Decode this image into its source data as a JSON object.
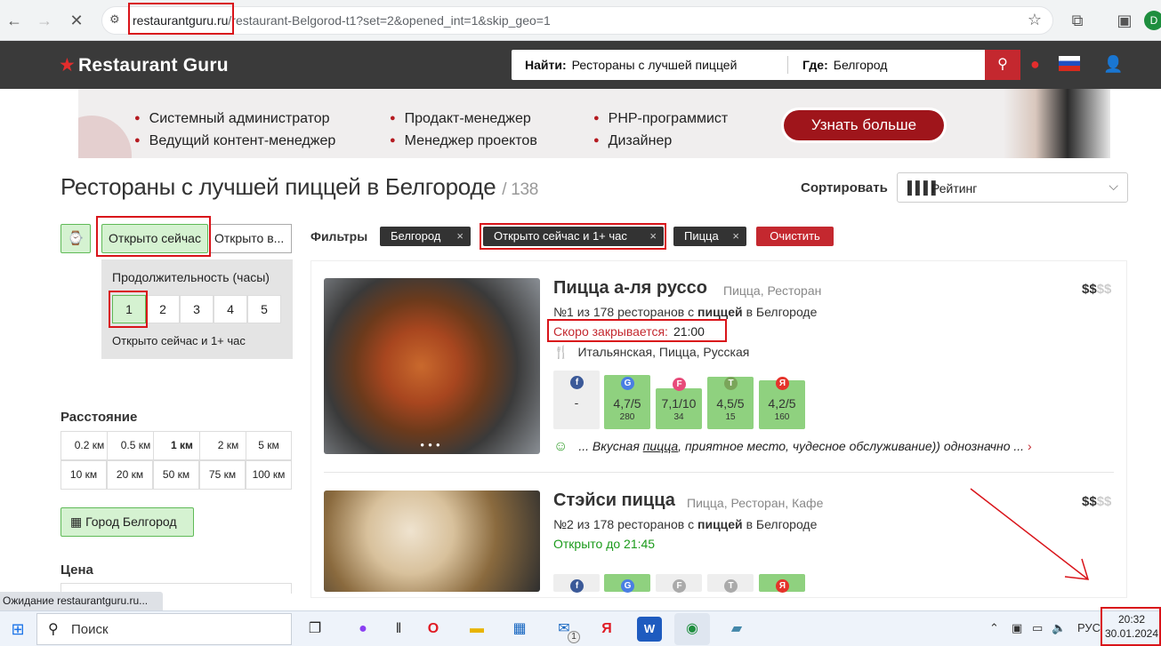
{
  "browser": {
    "url_host": "restaurantguru.ru",
    "url_path": "/restaurant-Belgorod-t1?set=2&opened_int=1&skip_geo=1",
    "profile_letter": "D"
  },
  "site": {
    "logo": "Restaurant Guru",
    "search_find_label": "Найти:",
    "search_find_value": "Рестораны с лучшей пиццей",
    "search_where_label": "Где:",
    "search_where_value": "Белгород"
  },
  "banner": {
    "col1": [
      "Системный администратор",
      "Ведущий контент-менеджер"
    ],
    "col2": [
      "Продакт-менеджер",
      "Менеджер проектов"
    ],
    "col3": [
      "PHP-программист",
      "Дизайнер"
    ],
    "button": "Узнать больше"
  },
  "page": {
    "title": "Рестораны с лучшей пиццей в Белгороде",
    "count": "/ 138",
    "sort_label": "Сортировать",
    "sort_value": "Рейтинг"
  },
  "sidebar": {
    "open_now": "Открыто сейчас",
    "open_at": "Открыто в...",
    "duration_title": "Продолжительность (часы)",
    "durations": [
      "1",
      "2",
      "3",
      "4",
      "5"
    ],
    "duration_note": "Открыто сейчас и 1+ час",
    "distance_title": "Расстояние",
    "distances": [
      "0.2 км",
      "0.5 км",
      "1 км",
      "2 км",
      "5 км",
      "10 км",
      "20 км",
      "50 км",
      "75 км",
      "100 км"
    ],
    "city_button": "Город Белгород",
    "price_title": "Цена"
  },
  "filters": {
    "label": "Фильтры",
    "chips": [
      "Белгород",
      "Открыто сейчас и 1+ час",
      "Пицца"
    ],
    "clear": "Очистить"
  },
  "restaurants": [
    {
      "name": "Пицца а-ля руссо",
      "type": "Пицца, Ресторан",
      "rank_prefix": "№1 из 178 ресторанов с",
      "rank_bold": "пиццей",
      "rank_suffix": "в Белгороде",
      "price_on": "$$",
      "price_off": "$$",
      "status": "Скоро закрывается:",
      "status_time": "21:00",
      "cuisine": "Итальянская, Пицца, Русская",
      "ratings": [
        {
          "src": "facebook",
          "letter": "f",
          "score": "-",
          "count": ""
        },
        {
          "src": "google",
          "letter": "G",
          "score": "4,7/5",
          "count": "280"
        },
        {
          "src": "foursquare",
          "letter": "F",
          "score": "7,1/10",
          "count": "34"
        },
        {
          "src": "tripadvisor",
          "letter": "T",
          "score": "4,5/5",
          "count": "15"
        },
        {
          "src": "yandex",
          "letter": "Я",
          "score": "4,2/5",
          "count": "160"
        }
      ],
      "review_pre": "... Вкусная",
      "review_link": "пицца",
      "review_post": ", приятное место, чудесное обслуживание)) однозначно ..."
    },
    {
      "name": "Стэйси пицца",
      "type": "Пицца, Ресторан, Кафе",
      "rank_prefix": "№2 из 178 ресторанов с",
      "rank_bold": "пиццей",
      "rank_suffix": "в Белгороде",
      "price_on": "$$",
      "price_off": "$$",
      "status": "Открыто до 21:45"
    }
  ],
  "status_bar": "Ожидание restaurantguru.ru...",
  "taskbar": {
    "search": "Поиск",
    "lang": "РУС",
    "time": "20:32",
    "date": "30.01.2024",
    "mail_badge": "1"
  }
}
